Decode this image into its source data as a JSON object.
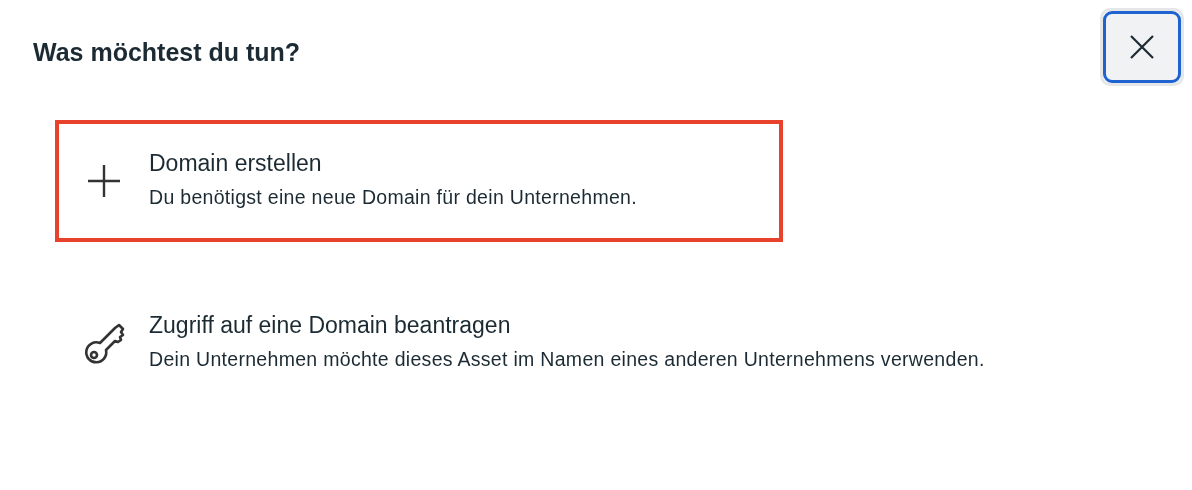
{
  "dialog": {
    "title": "Was möchtest du tun?"
  },
  "options": [
    {
      "kind": "plus",
      "title": "Domain erstellen",
      "description": "Du benötigst eine neue Domain für dein Unternehmen.",
      "highlighted": true
    },
    {
      "kind": "key",
      "title": "Zugriff auf eine Domain beantragen",
      "description": "Dein Unternehmen möchte dieses Asset im Namen eines anderen Unternehmens verwenden.",
      "highlighted": false
    }
  ]
}
